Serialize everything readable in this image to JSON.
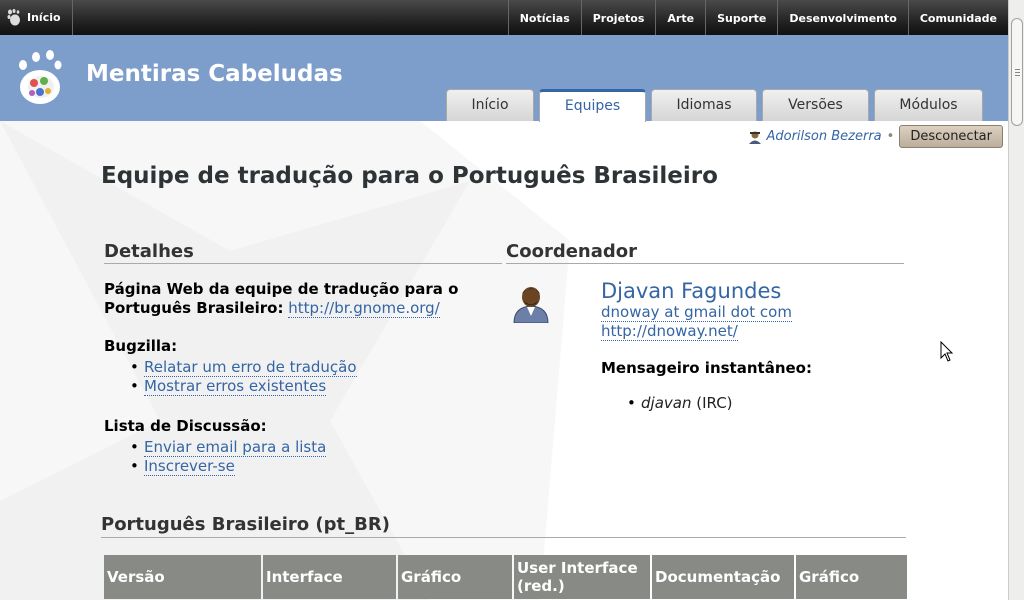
{
  "topbar": {
    "home_label": "Início",
    "nav": [
      "Notícias",
      "Projetos",
      "Arte",
      "Suporte",
      "Desenvolvimento",
      "Comunidade"
    ]
  },
  "header": {
    "site_title": "Mentiras Cabeludas",
    "tabs": [
      {
        "label": "Início",
        "active": false
      },
      {
        "label": "Equipes",
        "active": true
      },
      {
        "label": "Idiomas",
        "active": false
      },
      {
        "label": "Versões",
        "active": false
      },
      {
        "label": "Módulos",
        "active": false
      }
    ]
  },
  "user": {
    "name": "Adorilson Bezerra",
    "separator": "•",
    "logout_label": "Desconectar"
  },
  "page": {
    "title": "Equipe de tradução para o Português Brasileiro"
  },
  "details": {
    "heading": "Detalhes",
    "webpage_label": "Página Web da equipe de tradução para o Português Brasileiro:",
    "webpage_url": "http://br.gnome.org/",
    "bugzilla_label": "Bugzilla:",
    "bugzilla_links": [
      "Relatar um erro de tradução",
      "Mostrar erros existentes"
    ],
    "mailing_label": "Lista de Discussão:",
    "mailing_links": [
      "Enviar email para a lista",
      "Inscrever-se"
    ]
  },
  "coordinator": {
    "heading": "Coordenador",
    "name": "Djavan Fagundes",
    "email": "dnoway at gmail dot com",
    "website": "http://dnoway.net/",
    "im_label": "Mensageiro instantâneo:",
    "im_nick": "djavan",
    "im_network": "(IRC)"
  },
  "language_section": {
    "heading": "Português Brasileiro (pt_BR)",
    "columns": [
      "Versão",
      "Interface",
      "Gráfico",
      "User Interface (red.)",
      "Documentação",
      "Gráfico"
    ]
  },
  "colors": {
    "header_blue": "#7d9dcb",
    "link_blue": "#3465a4",
    "table_header": "#888a85"
  }
}
